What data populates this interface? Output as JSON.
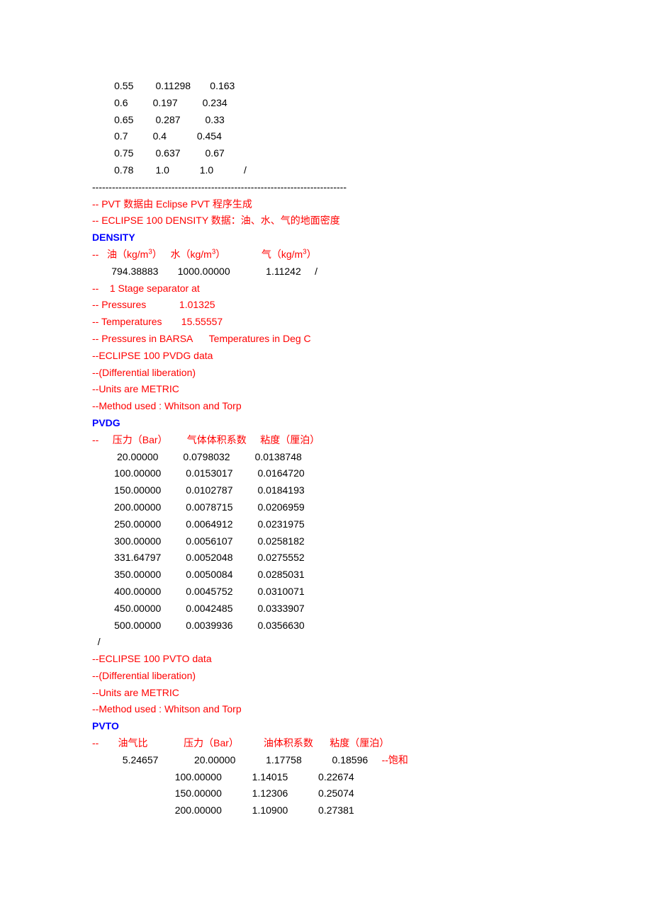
{
  "topTable": [
    [
      "0.55",
      "0.11298",
      "0.163",
      ""
    ],
    [
      "0.6",
      "0.197",
      "0.234",
      ""
    ],
    [
      "0.65",
      "0.287",
      "0.33",
      ""
    ],
    [
      "0.7",
      "0.4",
      "0.454",
      ""
    ],
    [
      "0.75",
      "0.637",
      "0.67",
      ""
    ],
    [
      "0.78",
      "1.0",
      "1.0",
      "/"
    ]
  ],
  "dashLine": "-----------------------------------------------------------------------------",
  "comments": {
    "pvtGen": "-- PVT 数据由 Eclipse PVT 程序生成",
    "densityDesc": "-- ECLIPSE 100 DENSITY 数据：油、水、气的地面密度"
  },
  "density": {
    "keyword": "DENSITY",
    "headerPrefix": "--   ",
    "oilLabel": "油（kg/m",
    "waterLabel": "水（kg/m",
    "gasLabel": "气（kg/m",
    "sup": "3",
    "close": "）",
    "values": "       794.38883       1000.00000             1.11242     /"
  },
  "separator": {
    "stage": "--    1 Stage separator at",
    "pressures": "-- Pressures            1.01325",
    "temperatures": "-- Temperatures       15.55557",
    "units": "-- Pressures in BARSA      Temperatures in Deg C"
  },
  "pvdgComments": {
    "data": "--ECLIPSE 100 PVDG data",
    "diff": "--(Differential liberation)",
    "units": "--Units are METRIC",
    "method": "--Method used : Whitson and Torp"
  },
  "pvdg": {
    "keyword": "PVDG",
    "headerPrefix": "--     ",
    "col1": "压力（Bar）",
    "col2": "气体体积系数",
    "col3": "粘度（厘泊）",
    "rows": [
      "         20.00000         0.0798032         0.0138748",
      "        100.00000         0.0153017         0.0164720",
      "        150.00000         0.0102787         0.0184193",
      "        200.00000         0.0078715         0.0206959",
      "        250.00000         0.0064912         0.0231975",
      "        300.00000         0.0056107         0.0258182",
      "        331.64797         0.0052048         0.0275552",
      "        350.00000         0.0050084         0.0285031",
      "        400.00000         0.0045752         0.0310071",
      "        450.00000         0.0042485         0.0333907",
      "        500.00000         0.0039936         0.0356630"
    ],
    "end": "  /"
  },
  "pvtoComments": {
    "data": "--ECLIPSE 100 PVTO data",
    "diff": "--(Differential liberation)",
    "units": "--Units are METRIC",
    "method": "--Method used : Whitson and Torp"
  },
  "pvto": {
    "keyword": "PVTO",
    "headerPrefix": "--       ",
    "col1": "油气比",
    "col2": "压力（Bar）",
    "col3": "油体积系数",
    "col4": "粘度（厘泊）",
    "rows": [
      {
        "text": "           5.24657             20.00000           1.17758           0.18596     ",
        "sat": "--饱和"
      },
      {
        "text": "                              100.00000           1.14015           0.22674",
        "sat": ""
      },
      {
        "text": "                              150.00000           1.12306           0.25074",
        "sat": ""
      },
      {
        "text": "                              200.00000           1.10900           0.27381",
        "sat": ""
      }
    ]
  }
}
